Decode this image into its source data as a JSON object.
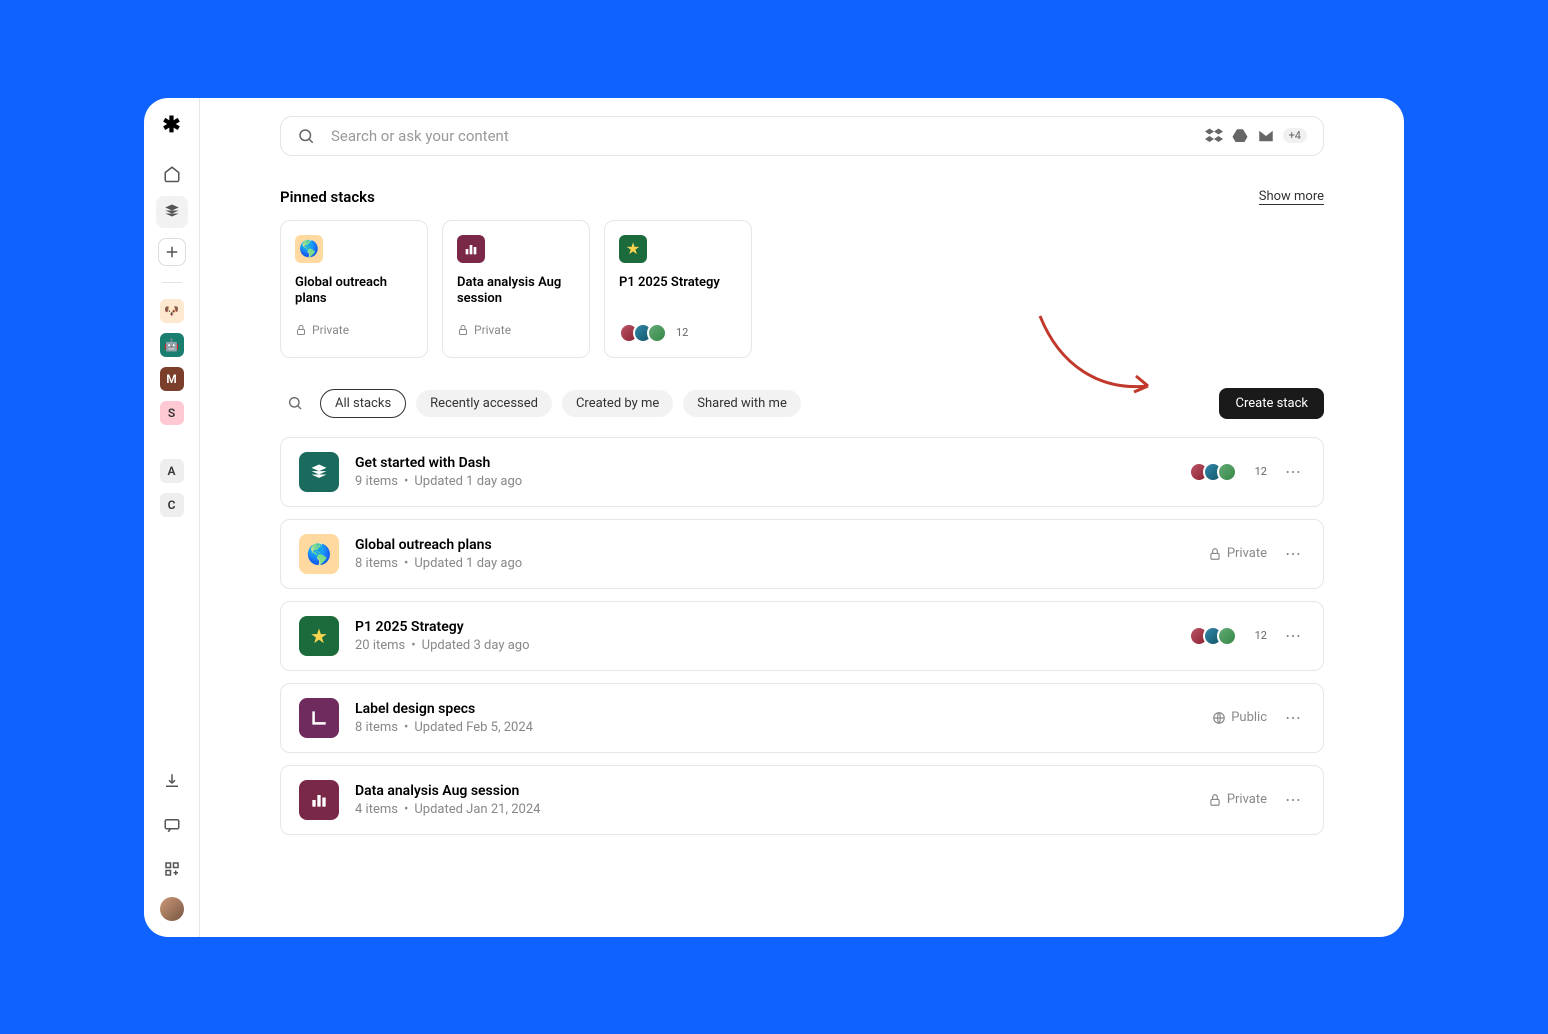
{
  "search": {
    "placeholder": "Search or ask your content",
    "more_apps_badge": "+4"
  },
  "pinned_section": {
    "title": "Pinned stacks",
    "show_more": "Show more"
  },
  "pinned": [
    {
      "title": "Global outreach plans",
      "visibility": "Private"
    },
    {
      "title": "Data analysis Aug session",
      "visibility": "Private"
    },
    {
      "title": "P1 2025 Strategy",
      "member_count": "12"
    }
  ],
  "filters": {
    "all": "All stacks",
    "recent": "Recently accessed",
    "created": "Created by me",
    "shared": "Shared with me"
  },
  "create_button": "Create stack",
  "stacks": [
    {
      "title": "Get started with Dash",
      "items": "9 items",
      "updated": "Updated 1 day ago",
      "member_count": "12"
    },
    {
      "title": "Global outreach plans",
      "items": "8 items",
      "updated": "Updated 1 day ago",
      "visibility": "Private"
    },
    {
      "title": "P1 2025 Strategy",
      "items": "20 items",
      "updated": "Updated 3 day ago",
      "member_count": "12"
    },
    {
      "title": "Label design specs",
      "items": "8 items",
      "updated": "Updated Feb 5, 2024",
      "visibility": "Public"
    },
    {
      "title": "Data analysis Aug session",
      "items": "4 items",
      "updated": "Updated Jan 21, 2024",
      "visibility": "Private"
    }
  ],
  "sidebar": {
    "workspaces": {
      "m": "M",
      "s": "S",
      "a": "A",
      "c": "C"
    }
  }
}
